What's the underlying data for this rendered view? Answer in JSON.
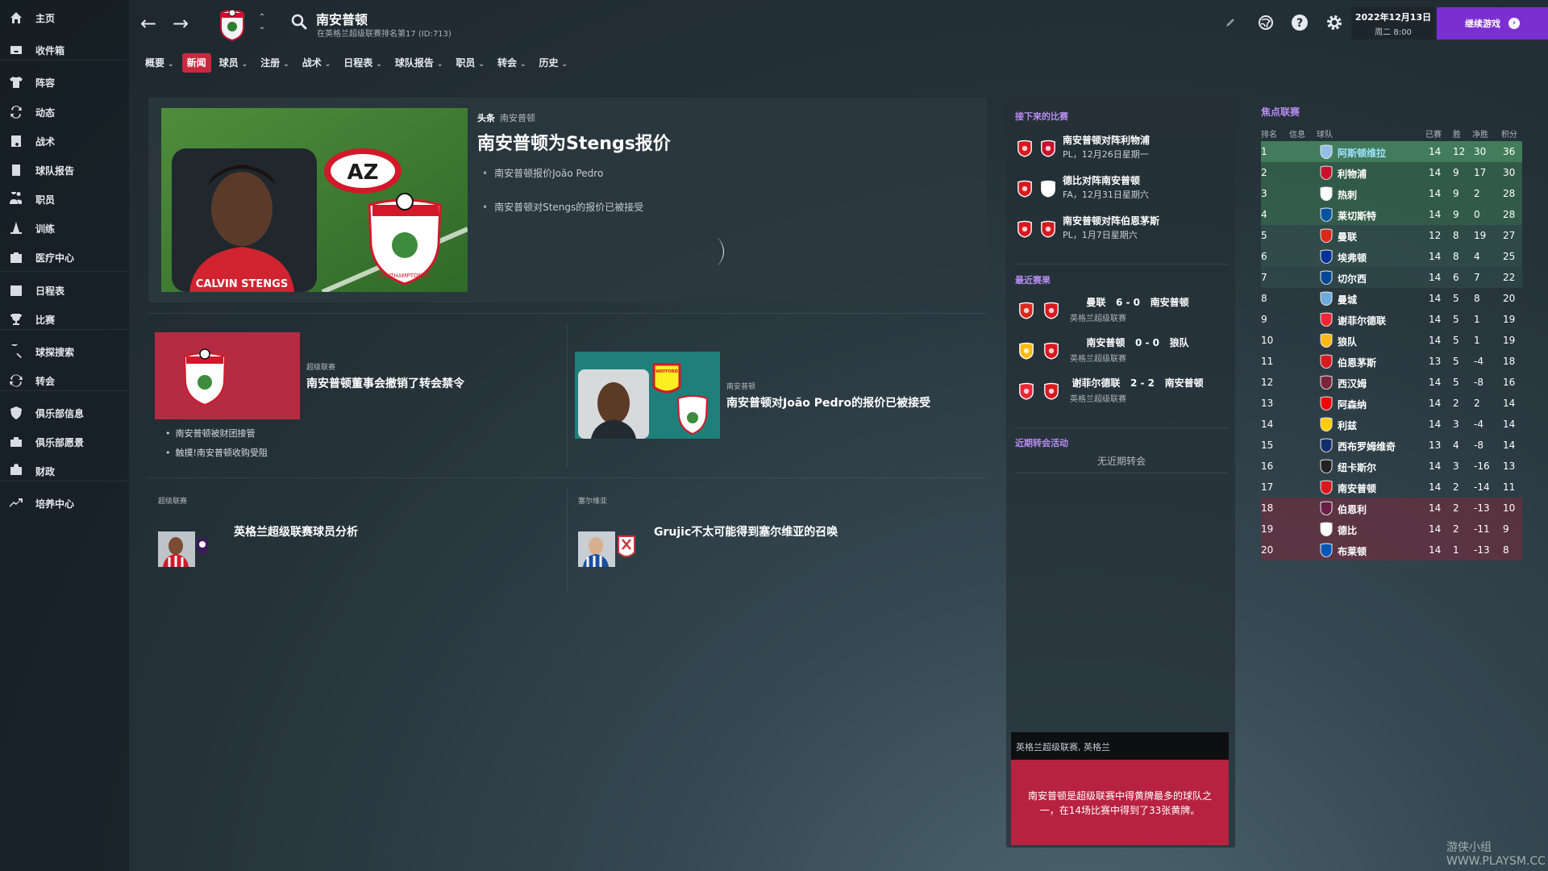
{
  "sidebar": {
    "items": [
      {
        "label": "主页",
        "icon": "home-icon"
      },
      {
        "label": "收件箱",
        "icon": "inbox-icon"
      },
      {
        "label": "阵容",
        "icon": "squad-shirt-icon"
      },
      {
        "label": "动态",
        "icon": "dynamics-icon"
      },
      {
        "label": "战术",
        "icon": "tactics-board-icon"
      },
      {
        "label": "球队报告",
        "icon": "report-icon"
      },
      {
        "label": "职员",
        "icon": "staff-icon"
      },
      {
        "label": "训练",
        "icon": "training-cone-icon"
      },
      {
        "label": "医疗中心",
        "icon": "medical-kit-icon"
      },
      {
        "label": "日程表",
        "icon": "calendar-icon"
      },
      {
        "label": "比赛",
        "icon": "trophy-icon"
      },
      {
        "label": "球探搜索",
        "icon": "scout-search-icon"
      },
      {
        "label": "转会",
        "icon": "transfer-arrows-icon"
      },
      {
        "label": "俱乐部信息",
        "icon": "club-shield-icon"
      },
      {
        "label": "俱乐部愿景",
        "icon": "vision-briefcase-icon"
      },
      {
        "label": "财政",
        "icon": "finance-icon"
      },
      {
        "label": "培养中心",
        "icon": "development-chart-icon"
      }
    ]
  },
  "header": {
    "club_name": "南安普顿",
    "club_subtitle": "在英格兰超级联赛排名第17 (ID:713)",
    "date_line1": "2022年12月13日",
    "date_line2": "周二 8:00",
    "continue_label": "继续游戏",
    "continue_arrow": "›"
  },
  "tabs": [
    {
      "label": "概要",
      "chevron": "⌄"
    },
    {
      "label": "新闻",
      "chevron": ""
    },
    {
      "label": "球员",
      "chevron": "⌄"
    },
    {
      "label": "注册",
      "chevron": "⌄"
    },
    {
      "label": "战术",
      "chevron": "⌄"
    },
    {
      "label": "日程表",
      "chevron": "⌄"
    },
    {
      "label": "球队报告",
      "chevron": "⌄"
    },
    {
      "label": "职员",
      "chevron": "⌄"
    },
    {
      "label": "转会",
      "chevron": "⌄"
    },
    {
      "label": "历史",
      "chevron": "⌄"
    }
  ],
  "headline": {
    "kicker_tag": "头条",
    "kicker_club": "南安普顿",
    "title": "南安普顿为Stengs报价",
    "bullets": [
      "南安普顿报价João Pedro",
      "南安普顿对Stengs的报价已被接受"
    ],
    "player_caption": "CALVIN STENGS",
    "az_logo_text": "AZ",
    "crest_text": "SOUTHAMPTON FC"
  },
  "stories": [
    {
      "kicker": "超级联赛",
      "title": "南安普顿董事会撤销了转会禁令",
      "bullets": [
        "南安普顿被财团接管",
        "触摸!南安普顿收购受阻"
      ]
    },
    {
      "kicker": "南安普顿",
      "title": "南安普顿对João Pedro的报价已被接受",
      "bullets": [],
      "badge_text": "WATFORD"
    },
    {
      "kicker": "超级联赛",
      "title": "英格兰超级联赛球员分析",
      "bullets": []
    },
    {
      "kicker": "塞尔维亚",
      "title": "Grujic不太可能得到塞尔维亚的召唤",
      "bullets": []
    }
  ],
  "upcoming": {
    "title": "接下来的比赛",
    "items": [
      {
        "title": "南安普顿对阵利物浦",
        "sub": "PL，12月26日星期一",
        "opp_color": "#c8102e"
      },
      {
        "title": "德比对阵南安普顿",
        "sub": "FA，12月31日星期六",
        "opp_color": "#ffffff"
      },
      {
        "title": "南安普顿对阵伯恩茅斯",
        "sub": "PL，1月7日星期六",
        "opp_color": "#d71920"
      }
    ]
  },
  "recent": {
    "title": "最近赛果",
    "items": [
      {
        "home": "曼联",
        "score": "6 - 0",
        "away": "南安普顿",
        "comp": "英格兰超级联赛",
        "opp_color": "#da291c"
      },
      {
        "home": "南安普顿",
        "score": "0 - 0",
        "away": "狼队",
        "comp": "英格兰超级联赛",
        "opp_color": "#fdb913"
      },
      {
        "home": "谢菲尔德联",
        "score": "2 - 2",
        "away": "南安普顿",
        "comp": "英格兰超级联赛",
        "opp_color": "#ee2737"
      }
    ]
  },
  "transfers": {
    "title": "近期转会活动",
    "empty": "无近期转会"
  },
  "fact": {
    "header": "英格兰超级联赛, 英格兰",
    "body": "南安普顿是超级联赛中得黄牌最多的球队之一，在14场比赛中得到了33张黄牌。"
  },
  "league_table": {
    "title": "焦点联赛",
    "headers": {
      "pos": "排名",
      "info": "信息",
      "team": "球队",
      "played": "已赛",
      "won": "胜",
      "gd": "净胜",
      "pts": "积分"
    },
    "rows": [
      {
        "pos": "1",
        "team": "阿斯顿维拉",
        "played": "14",
        "won": "12",
        "gd": "30",
        "pts": "36",
        "zone": "ucl",
        "crest": "#95bfe5",
        "highlight": true
      },
      {
        "pos": "2",
        "team": "利物浦",
        "played": "14",
        "won": "9",
        "gd": "17",
        "pts": "30",
        "zone": "ucl",
        "crest": "#c8102e"
      },
      {
        "pos": "3",
        "team": "热刺",
        "played": "14",
        "won": "9",
        "gd": "2",
        "pts": "28",
        "zone": "ucl",
        "crest": "#ffffff"
      },
      {
        "pos": "4",
        "team": "莱切斯特",
        "played": "14",
        "won": "9",
        "gd": "0",
        "pts": "28",
        "zone": "ucl",
        "crest": "#0053a0"
      },
      {
        "pos": "5",
        "team": "曼联",
        "played": "12",
        "won": "8",
        "gd": "19",
        "pts": "27",
        "zone": "uel",
        "crest": "#da291c"
      },
      {
        "pos": "6",
        "team": "埃弗顿",
        "played": "14",
        "won": "8",
        "gd": "4",
        "pts": "25",
        "zone": "uel",
        "crest": "#003399"
      },
      {
        "pos": "7",
        "team": "切尔西",
        "played": "14",
        "won": "6",
        "gd": "7",
        "pts": "22",
        "zone": "uecl",
        "crest": "#034694"
      },
      {
        "pos": "8",
        "team": "曼城",
        "played": "14",
        "won": "5",
        "gd": "8",
        "pts": "20",
        "zone": "",
        "crest": "#6cabdd"
      },
      {
        "pos": "9",
        "team": "谢菲尔德联",
        "played": "14",
        "won": "5",
        "gd": "1",
        "pts": "19",
        "zone": "",
        "crest": "#ee2737"
      },
      {
        "pos": "10",
        "team": "狼队",
        "played": "14",
        "won": "5",
        "gd": "1",
        "pts": "19",
        "zone": "",
        "crest": "#fdb913"
      },
      {
        "pos": "11",
        "team": "伯恩茅斯",
        "played": "13",
        "won": "5",
        "gd": "-4",
        "pts": "18",
        "zone": "",
        "crest": "#d71920"
      },
      {
        "pos": "12",
        "team": "西汉姆",
        "played": "14",
        "won": "5",
        "gd": "-8",
        "pts": "16",
        "zone": "",
        "crest": "#7a263a"
      },
      {
        "pos": "13",
        "team": "阿森纳",
        "played": "14",
        "won": "2",
        "gd": "2",
        "pts": "14",
        "zone": "",
        "crest": "#ef0107"
      },
      {
        "pos": "14",
        "team": "利兹",
        "played": "14",
        "won": "3",
        "gd": "-4",
        "pts": "14",
        "zone": "",
        "crest": "#ffcd00"
      },
      {
        "pos": "15",
        "team": "西布罗姆维奇",
        "played": "13",
        "won": "4",
        "gd": "-8",
        "pts": "14",
        "zone": "",
        "crest": "#122f67"
      },
      {
        "pos": "16",
        "team": "纽卡斯尔",
        "played": "14",
        "won": "3",
        "gd": "-16",
        "pts": "13",
        "zone": "",
        "crest": "#241f20"
      },
      {
        "pos": "17",
        "team": "南安普顿",
        "played": "14",
        "won": "2",
        "gd": "-14",
        "pts": "11",
        "zone": "",
        "crest": "#d71920"
      },
      {
        "pos": "18",
        "team": "伯恩利",
        "played": "14",
        "won": "2",
        "gd": "-13",
        "pts": "10",
        "zone": "rel",
        "crest": "#6c1d45"
      },
      {
        "pos": "19",
        "team": "德比",
        "played": "14",
        "won": "2",
        "gd": "-11",
        "pts": "9",
        "zone": "rel",
        "crest": "#ffffff"
      },
      {
        "pos": "20",
        "team": "布莱顿",
        "played": "14",
        "won": "1",
        "gd": "-13",
        "pts": "8",
        "zone": "rel",
        "crest": "#0057b8"
      }
    ]
  },
  "watermark": "游侠小组 WWW.PLAYSM.CC",
  "colors": {
    "accent_purple": "#7c2fd1",
    "news_tab_red": "#c8283e",
    "section_title": "#b78cf0",
    "fact_red": "#b82241"
  }
}
